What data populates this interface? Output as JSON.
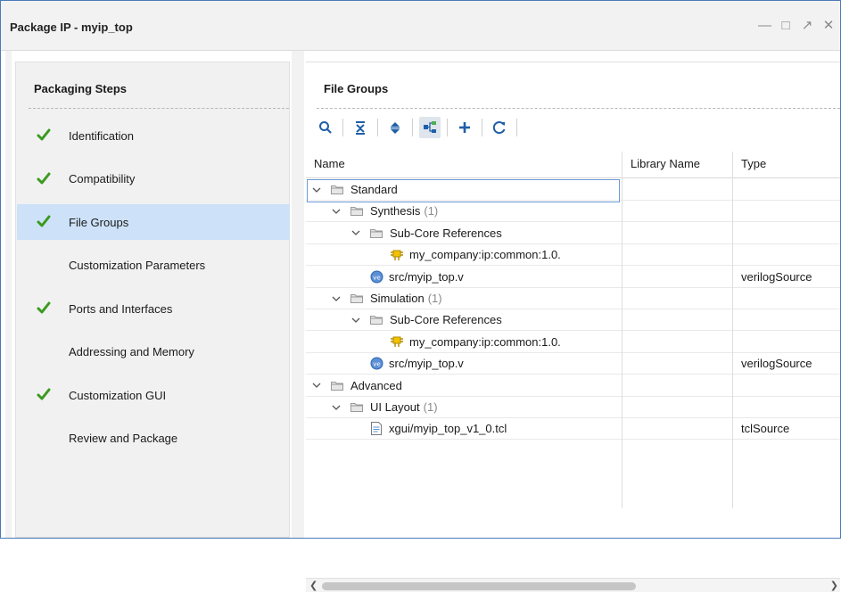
{
  "window": {
    "title": "Package IP - myip_top",
    "controls": [
      "minimize-icon",
      "maximize-icon",
      "restore-icon",
      "close-icon"
    ]
  },
  "sidebar": {
    "title": "Packaging Steps",
    "steps": [
      {
        "label": "Identification",
        "done": true,
        "selected": false
      },
      {
        "label": "Compatibility",
        "done": true,
        "selected": false
      },
      {
        "label": "File Groups",
        "done": true,
        "selected": true
      },
      {
        "label": "Customization Parameters",
        "done": false,
        "selected": false
      },
      {
        "label": "Ports and Interfaces",
        "done": true,
        "selected": false
      },
      {
        "label": "Addressing and Memory",
        "done": false,
        "selected": false
      },
      {
        "label": "Customization GUI",
        "done": true,
        "selected": false
      },
      {
        "label": "Review and Package",
        "done": false,
        "selected": false
      }
    ]
  },
  "main": {
    "title": "File Groups",
    "toolbar": [
      "search-icon",
      "collapse-all-icon",
      "expand-all-icon",
      "hierarchy-icon",
      "add-icon",
      "refresh-icon"
    ],
    "columns": [
      "Name",
      "Library Name",
      "Type"
    ],
    "rows": [
      {
        "name": "Standard",
        "count": "",
        "library": "",
        "type": "",
        "level": 0,
        "icon": "folder",
        "expandable": true
      },
      {
        "name": "Synthesis",
        "count": "(1)",
        "library": "",
        "type": "",
        "level": 1,
        "icon": "folder",
        "expandable": true
      },
      {
        "name": "Sub-Core References",
        "count": "",
        "library": "",
        "type": "",
        "level": 2,
        "icon": "folder",
        "expandable": true
      },
      {
        "name": "my_company:ip:common:1.0.",
        "count": "",
        "library": "",
        "type": "",
        "level": 3,
        "icon": "ip-core",
        "expandable": false
      },
      {
        "name": "src/myip_top.v",
        "count": "",
        "library": "",
        "type": "verilogSource",
        "level": 2,
        "icon": "verilog-file",
        "expandable": false
      },
      {
        "name": "Simulation",
        "count": "(1)",
        "library": "",
        "type": "",
        "level": 1,
        "icon": "folder",
        "expandable": true
      },
      {
        "name": "Sub-Core References",
        "count": "",
        "library": "",
        "type": "",
        "level": 2,
        "icon": "folder",
        "expandable": true
      },
      {
        "name": "my_company:ip:common:1.0.",
        "count": "",
        "library": "",
        "type": "",
        "level": 3,
        "icon": "ip-core",
        "expandable": false
      },
      {
        "name": "src/myip_top.v",
        "count": "",
        "library": "",
        "type": "verilogSource",
        "level": 2,
        "icon": "verilog-file",
        "expandable": false
      },
      {
        "name": "Advanced",
        "count": "",
        "library": "",
        "type": "",
        "level": 0,
        "icon": "folder",
        "expandable": true
      },
      {
        "name": "UI Layout",
        "count": "(1)",
        "library": "",
        "type": "",
        "level": 1,
        "icon": "folder",
        "expandable": true
      },
      {
        "name": "xgui/myip_top_v1_0.tcl",
        "count": "",
        "library": "",
        "type": "tclSource",
        "level": 2,
        "icon": "tcl-file",
        "expandable": false
      }
    ]
  },
  "colors": {
    "accent_border": "#4a7ab8",
    "selected_bg": "#cde2f8",
    "check_green": "#3a9a1e",
    "toolbar_blue": "#1f5fa8"
  }
}
